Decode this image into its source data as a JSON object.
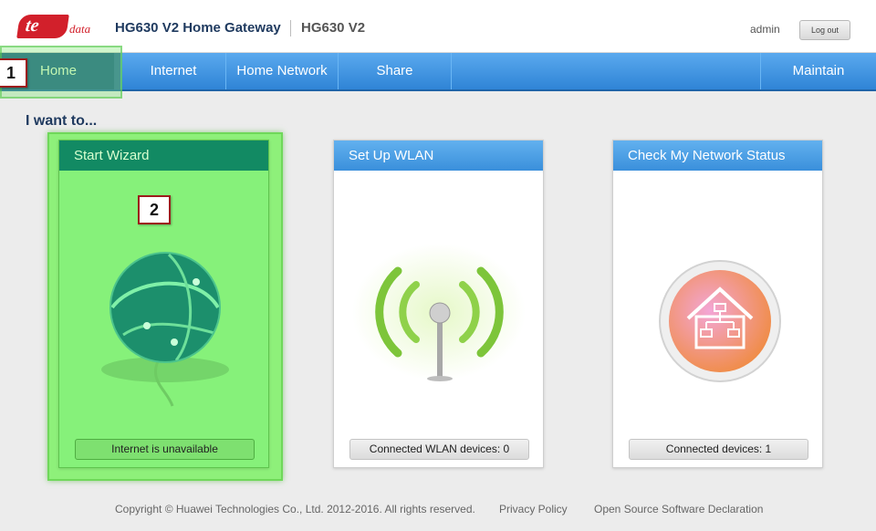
{
  "brand": {
    "logo_text": "te",
    "logo_sub": "data",
    "color": "#d2202b"
  },
  "header": {
    "title": "HG630 V2 Home Gateway",
    "model": "HG630 V2",
    "user": "admin",
    "logout_label": "Log out"
  },
  "nav": {
    "items": [
      {
        "label": "Home",
        "active": true
      },
      {
        "label": "Internet"
      },
      {
        "label": "Home Network"
      },
      {
        "label": "Share"
      },
      {
        "label": "Maintain"
      }
    ]
  },
  "markers": {
    "one": "1",
    "two": "2"
  },
  "main": {
    "heading": "I want to...",
    "cards": [
      {
        "title": "Start Wizard",
        "icon": "globe-icon",
        "status": "Internet is unavailable"
      },
      {
        "title": "Set Up WLAN",
        "icon": "wifi-antenna-icon",
        "status": "Connected WLAN devices: 0"
      },
      {
        "title": "Check My Network Status",
        "icon": "home-network-icon",
        "status": "Connected devices: 1"
      }
    ]
  },
  "footer": {
    "copyright": "Copyright © Huawei Technologies Co., Ltd. 2012-2016. All rights reserved.",
    "privacy": "Privacy Policy",
    "oss": "Open Source Software Declaration"
  },
  "colors": {
    "nav_blue": "#3a8fdb",
    "highlight_green": "#8ef07a",
    "wizard_header": "#128a63"
  }
}
